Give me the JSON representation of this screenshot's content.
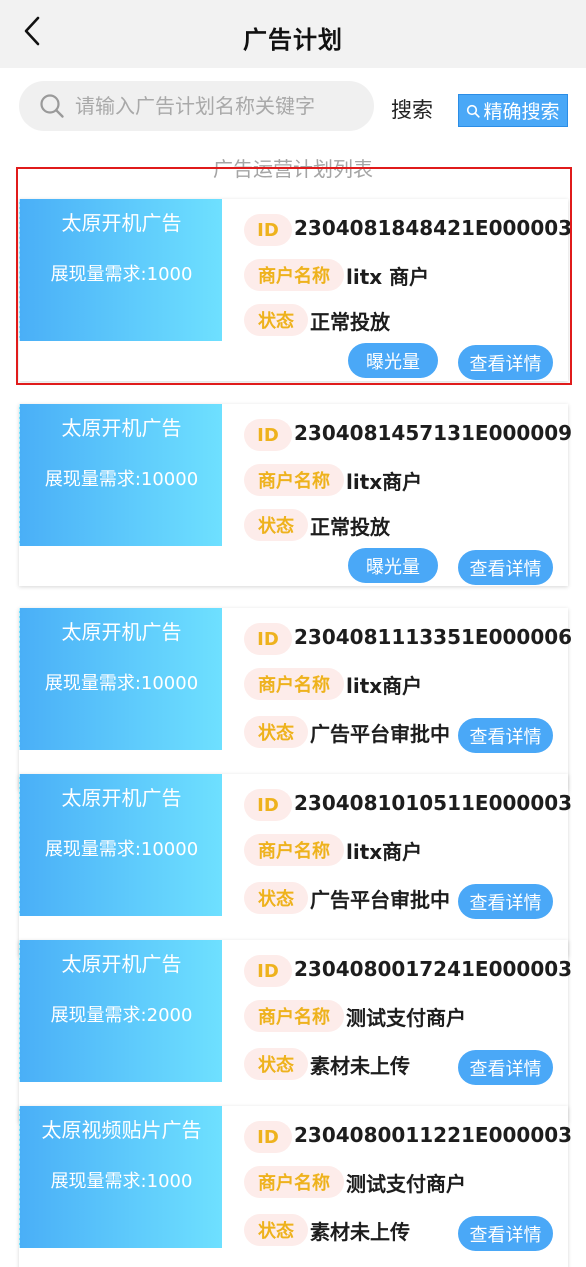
{
  "header": {
    "title": "广告计划",
    "back_icon": "chevron-left-icon"
  },
  "search": {
    "placeholder": "请输入广告计划名称关键字",
    "value": "",
    "search_label": "搜索",
    "precise_label": "精确搜索",
    "icon": "search-icon"
  },
  "list": {
    "title": "广告运营计划列表",
    "id_tag": "ID",
    "merchant_tag": "商户名称",
    "status_tag": "状态",
    "exposure_label": "曝光量",
    "detail_label": "查看详情"
  },
  "colors": {
    "accent": "#4aa8f7",
    "tag_bg": "#fdecea",
    "tag_text": "#eeb21d",
    "highlight": "#e01b1b"
  },
  "plans": [
    {
      "name": "太原开机广告",
      "demand": "展现量需求:1000",
      "id": "2304081848421E000003",
      "merchant": "litx 商户",
      "status": "正常投放",
      "has_exposure": true,
      "highlighted": true
    },
    {
      "name": "太原开机广告",
      "demand": "展现量需求:10000",
      "id": "2304081457131E000009",
      "merchant": "litx商户",
      "status": "正常投放",
      "has_exposure": true
    },
    {
      "name": "太原开机广告",
      "demand": "展现量需求:10000",
      "id": "2304081113351E000006",
      "merchant": "litx商户",
      "status": "广告平台审批中",
      "has_exposure": false
    },
    {
      "name": "太原开机广告",
      "demand": "展现量需求:10000",
      "id": "2304081010511E000003",
      "merchant": "litx商户",
      "status": "广告平台审批中",
      "has_exposure": false
    },
    {
      "name": "太原开机广告",
      "demand": "展现量需求:2000",
      "id": "2304080017241E000003",
      "merchant": "测试支付商户",
      "status": "素材未上传",
      "has_exposure": false
    },
    {
      "name": "太原视频贴片广告",
      "demand": "展现量需求:1000",
      "id": "2304080011221E000003",
      "merchant": "测试支付商户",
      "status": "素材未上传",
      "has_exposure": false
    }
  ]
}
